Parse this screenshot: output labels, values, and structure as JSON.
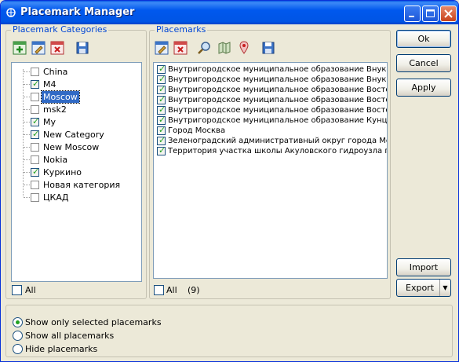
{
  "window": {
    "title": "Placemark Manager"
  },
  "categories": {
    "legend": "Placemark Categories",
    "items": [
      {
        "label": "China",
        "checked": false,
        "selected": false
      },
      {
        "label": "M4",
        "checked": true,
        "selected": false
      },
      {
        "label": "Moscow",
        "checked": false,
        "selected": true
      },
      {
        "label": "msk2",
        "checked": false,
        "selected": false
      },
      {
        "label": "My",
        "checked": true,
        "selected": false
      },
      {
        "label": "New Category",
        "checked": true,
        "selected": false
      },
      {
        "label": "New Moscow",
        "checked": false,
        "selected": false
      },
      {
        "label": "Nokia",
        "checked": false,
        "selected": false
      },
      {
        "label": "Куркино",
        "checked": true,
        "selected": false
      },
      {
        "label": "Новая категория",
        "checked": false,
        "selected": false
      },
      {
        "label": "ЦКАД",
        "checked": false,
        "selected": false
      }
    ],
    "all_label": "All"
  },
  "placemarks": {
    "legend": "Placemarks",
    "items": [
      {
        "label": "Внутригородское муниципальное образование Внуково",
        "checked": true
      },
      {
        "label": "Внутригородское муниципальное образование Внуково",
        "checked": true
      },
      {
        "label": "Внутригородское муниципальное образование Восточное",
        "checked": true
      },
      {
        "label": "Внутригородское муниципальное образование Восточное",
        "checked": true
      },
      {
        "label": "Внутригородское муниципальное образование Восточное",
        "checked": true
      },
      {
        "label": "Внутригородское муниципальное образование Кунцево",
        "checked": true
      },
      {
        "label": "Город Москва",
        "checked": true
      },
      {
        "label": "Зеленоградский административный округ города Москвы",
        "checked": true
      },
      {
        "label": "Территория участка школы Акуловского гидроузла пл",
        "checked": true
      }
    ],
    "all_label": "All",
    "count": "(9)"
  },
  "buttons": {
    "ok": "Ok",
    "cancel": "Cancel",
    "apply": "Apply",
    "import": "Import",
    "export": "Export"
  },
  "display_options": {
    "items": [
      {
        "label": "Show only selected placemarks",
        "selected": true
      },
      {
        "label": "Show all placemarks",
        "selected": false
      },
      {
        "label": "Hide placemarks",
        "selected": false
      }
    ]
  },
  "colors": {
    "title_bar": "#0058ee",
    "selection": "#316ac5",
    "legend_text": "#0046d5",
    "check_mark": "#21a121"
  }
}
